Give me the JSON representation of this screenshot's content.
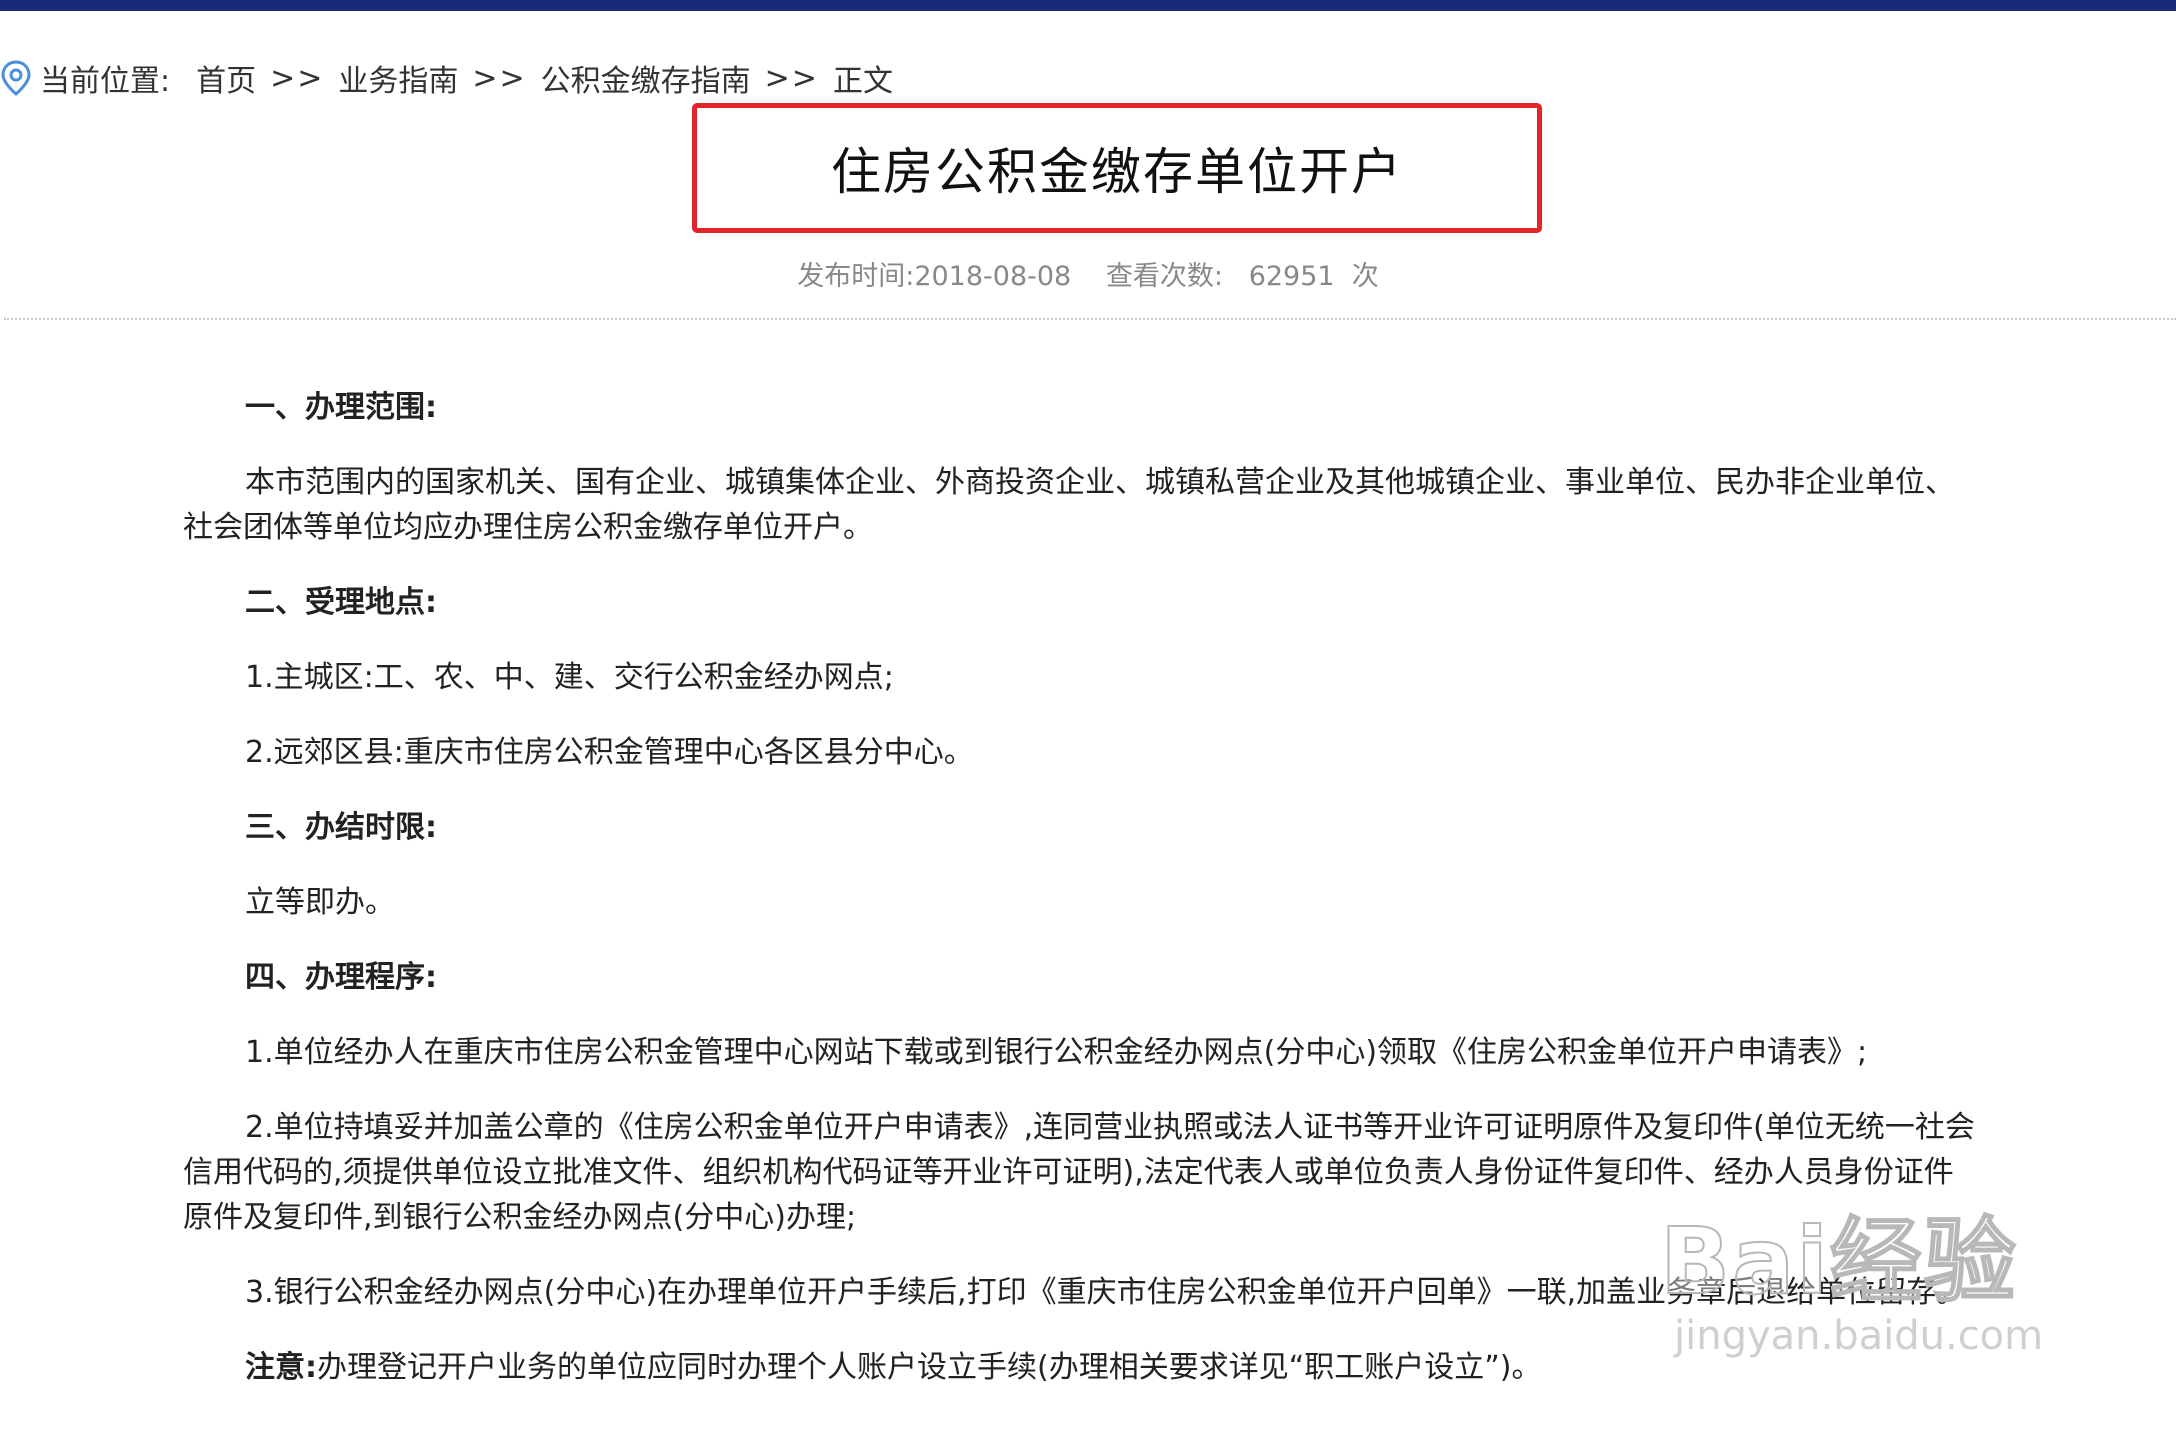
{
  "breadcrumb": {
    "label": "当前位置:",
    "items": [
      "首页",
      "业务指南",
      "公积金缴存指南",
      "正文"
    ],
    "separator": ">>"
  },
  "article": {
    "title": "住房公积金缴存单位开户",
    "publish_time": "发布时间:2018-08-08",
    "view_label": "查看次数:",
    "view_count": "62951",
    "view_unit": "次",
    "sections": [
      {
        "heading": "一、办理范围:",
        "paragraphs": [
          "本市范围内的国家机关、国有企业、城镇集体企业、外商投资企业、城镇私营企业及其他城镇企业、事业单位、民办非企业单位、社会团体等单位均应办理住房公积金缴存单位开户。"
        ]
      },
      {
        "heading": "二、受理地点:",
        "paragraphs": [
          "1.主城区:工、农、中、建、交行公积金经办网点;",
          "2.远郊区县:重庆市住房公积金管理中心各区县分中心。"
        ]
      },
      {
        "heading": "三、办结时限:",
        "paragraphs": [
          "立等即办。"
        ]
      },
      {
        "heading": "四、办理程序:",
        "paragraphs": [
          "1.单位经办人在重庆市住房公积金管理中心网站下载或到银行公积金经办网点(分中心)领取《住房公积金单位开户申请表》;",
          "2.单位持填妥并加盖公章的《住房公积金单位开户申请表》,连同营业执照或法人证书等开业许可证明原件及复印件(单位无统一社会信用代码的,须提供单位设立批准文件、组织机构代码证等开业许可证明),法定代表人或单位负责人身份证件复印件、经办人员身份证件原件及复印件,到银行公积金经办网点(分中心)办理;",
          "3.银行公积金经办网点(分中心)在办理单位开户手续后,打印《重庆市住房公积金单位开户回单》一联,加盖业务章后退给单位留存。"
        ]
      }
    ],
    "note_label": "注意:",
    "note_text": "办理登记开户业务的单位应同时办理个人账户设立手续(办理相关要求详见“职工账户设立”)。"
  },
  "watermark": {
    "logo": "Bai经验",
    "url": "jingyan.baidu.com"
  },
  "colors": {
    "top_bar": "#1a2a7a",
    "highlight_box": "#e0252b",
    "meta_text": "#888888"
  }
}
